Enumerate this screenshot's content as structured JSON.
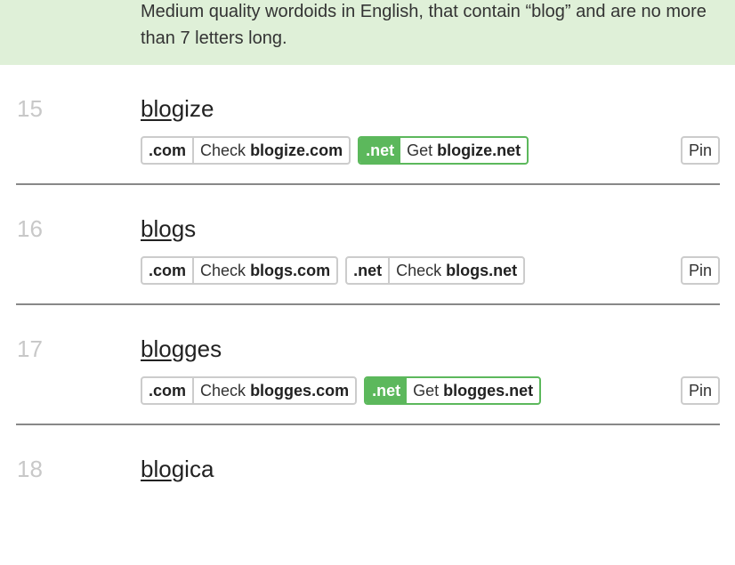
{
  "banner": {
    "text": "Medium quality wordoids in English, that contain “blog” and are no more than 7 letters long."
  },
  "pin_label": "Pin",
  "entries": [
    {
      "number": "15",
      "highlight": "blo",
      "rest": "gize",
      "domains": [
        {
          "tld": ".com",
          "action": "Check",
          "domain": "blogize.com",
          "available": false
        },
        {
          "tld": ".net",
          "action": "Get",
          "domain": "blogize.net",
          "available": true
        }
      ]
    },
    {
      "number": "16",
      "highlight": "blo",
      "rest": "gs",
      "domains": [
        {
          "tld": ".com",
          "action": "Check",
          "domain": "blogs.com",
          "available": false
        },
        {
          "tld": ".net",
          "action": "Check",
          "domain": "blogs.net",
          "available": false
        }
      ]
    },
    {
      "number": "17",
      "highlight": "blo",
      "rest": "gges",
      "domains": [
        {
          "tld": ".com",
          "action": "Check",
          "domain": "blogges.com",
          "available": false
        },
        {
          "tld": ".net",
          "action": "Get",
          "domain": "blogges.net",
          "available": true
        }
      ]
    },
    {
      "number": "18",
      "highlight": "blo",
      "rest": "gica",
      "domains": []
    }
  ],
  "colors": {
    "banner_bg": "#dff0d8",
    "available_green": "#5cb85c",
    "separator": "#888888",
    "number_gray": "#c8c8c8"
  }
}
